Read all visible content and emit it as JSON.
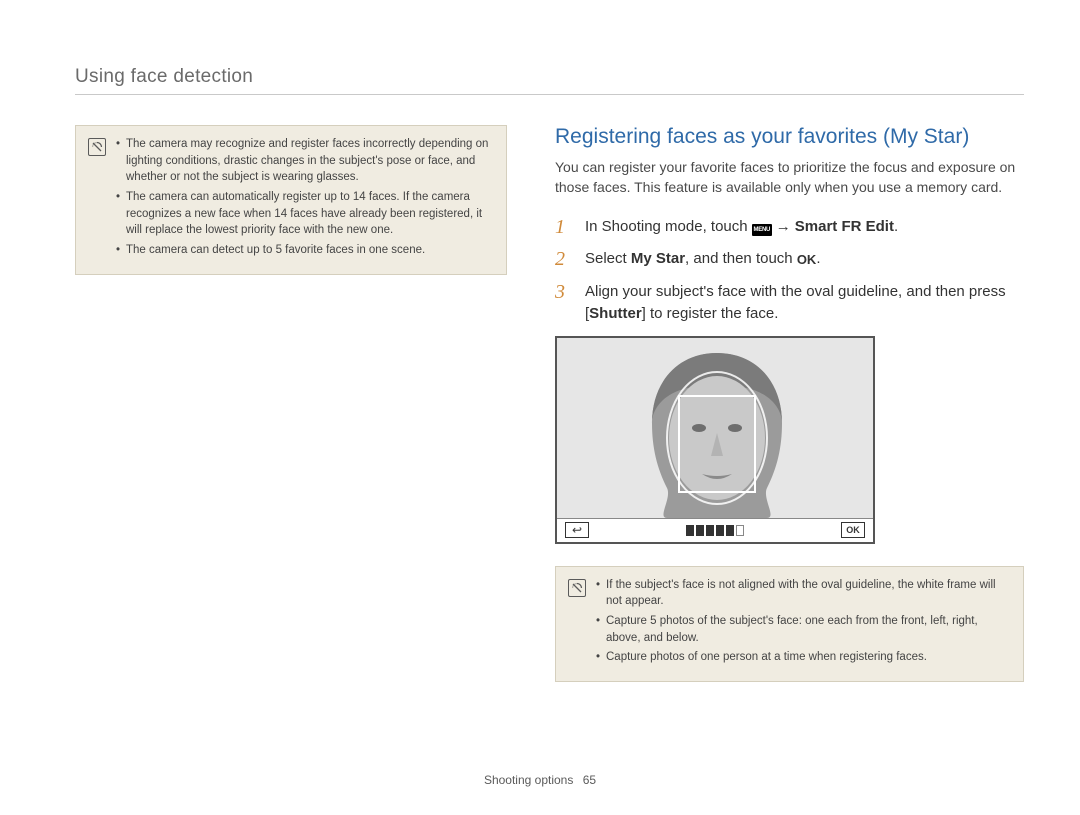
{
  "section_title": "Using face detection",
  "left_notes": [
    "The camera may recognize and register faces incorrectly depending on lighting conditions, drastic changes in the subject's pose or face, and whether or not the subject is wearing glasses.",
    "The camera can automatically register up to 14 faces. If the camera recognizes a new face when 14 faces have already been registered, it will replace the lowest priority face with the new one.",
    "The camera can detect up to 5 favorite faces in one scene."
  ],
  "topic_title": "Registering faces as your favorites (My Star)",
  "topic_intro": "You can register your favorite faces to prioritize the focus and exposure on those faces. This feature is available only when you use a memory card.",
  "steps": [
    {
      "num": "1",
      "pre": "In Shooting mode, touch ",
      "menu_label": "MENU",
      "arrow": "→",
      "bold_after": "Smart FR Edit",
      "post": "."
    },
    {
      "num": "2",
      "pre": "Select ",
      "bold": "My Star",
      "mid": ", and then touch ",
      "ok_label": "OK",
      "post": "."
    },
    {
      "num": "3",
      "pre": "Align your subject's face with the oval guideline, and then press [",
      "bold": "Shutter",
      "post": "] to register the face."
    }
  ],
  "lcd": {
    "back_glyph": "↩",
    "ok_label": "OK"
  },
  "right_notes": [
    "If the subject's face is not aligned with the oval guideline, the white frame will not appear.",
    "Capture 5 photos of the subject's face: one each from the front, left, right, above, and below.",
    "Capture photos of one person at a time when registering faces."
  ],
  "footer": {
    "label": "Shooting options",
    "page": "65"
  }
}
